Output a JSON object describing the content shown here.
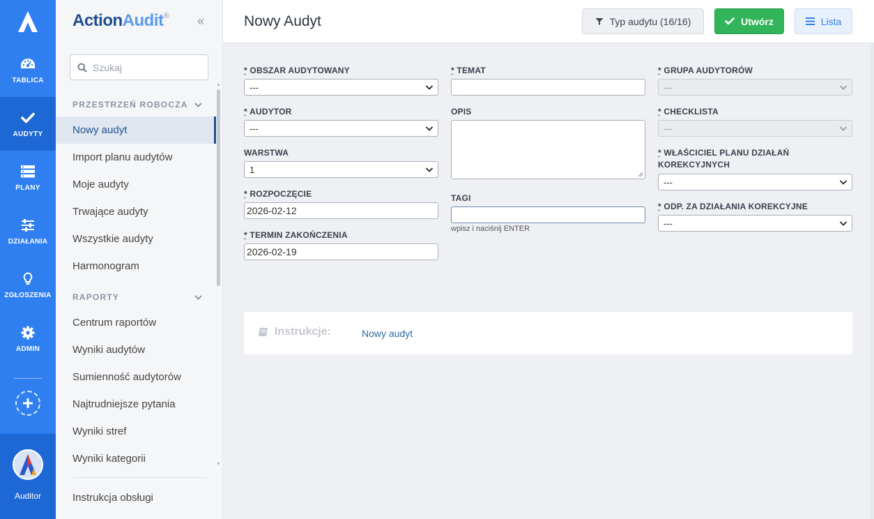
{
  "rail": {
    "items": [
      {
        "label": "TABLICA",
        "icon": "dashboard-icon"
      },
      {
        "label": "AUDYTY",
        "icon": "check-icon"
      },
      {
        "label": "PLANY",
        "icon": "plans-icon"
      },
      {
        "label": "DZIAŁANIA",
        "icon": "sliders-icon"
      },
      {
        "label": "ZGŁOSZENIA",
        "icon": "lightbulb-icon"
      },
      {
        "label": "ADMIN",
        "icon": "gear-icon"
      }
    ],
    "active_index": 1,
    "user_label": "Auditor"
  },
  "sidebar": {
    "brand_part1": "Action",
    "brand_part2": "Audit",
    "brand_reg": "®",
    "search_placeholder": "Szukaj",
    "sections": [
      {
        "title": "PRZESTRZEŃ ROBOCZA",
        "items": [
          "Nowy audyt",
          "Import planu audytów",
          "Moje audyty",
          "Trwające audyty",
          "Wszystkie audyty",
          "Harmonogram"
        ]
      },
      {
        "title": "RAPORTY",
        "items": [
          "Centrum raportów",
          "Wyniki audytów",
          "Sumienność audytorów",
          "Najtrudniejsze pytania",
          "Wyniki stref",
          "Wyniki kategorii"
        ]
      }
    ],
    "footer_item": "Instrukcja obsługi"
  },
  "header": {
    "title": "Nowy Audyt",
    "type_button": "Typ audytu (16/16)",
    "create_button": "Utwórz",
    "list_button": "Lista"
  },
  "form": {
    "col1": {
      "obszar_label": "OBSZAR AUDYTOWANY",
      "obszar_value": "---",
      "audytor_label": "AUDYTOR",
      "audytor_value": "---",
      "warstwa_label": "WARSTWA",
      "warstwa_value": "1",
      "rozpoczecie_label": "ROZPOCZĘCIE",
      "rozpoczecie_value": "2026-02-12",
      "termin_label": "TERMIN ZAKOŃCZENIA",
      "termin_value": "2026-02-19"
    },
    "col2": {
      "temat_label": "TEMAT",
      "temat_value": "",
      "opis_label": "OPIS",
      "tagi_label": "TAGI",
      "tagi_hint": "wpisz i naciśnij ENTER"
    },
    "col3": {
      "grupa_label": "GRUPA AUDYTORÓW",
      "grupa_value": "---",
      "checklista_label": "CHECKLISTA",
      "checklista_value": "---",
      "wlasciciel_label_1": "WŁAŚCICIEL PLANU DZIAŁAŃ",
      "wlasciciel_label_2": "KOREKCYJNYCH",
      "wlasciciel_value": "---",
      "odp_label": "ODP. ZA DZIAŁANIA KOREKCYJNE",
      "odp_value": "---"
    },
    "required_mark": "*"
  },
  "instructions": {
    "label": "Instrukcje:",
    "link": "Nowy audyt"
  },
  "colors": {
    "rail": "#2f7ff0",
    "rail_active": "#1e68d6",
    "create_green": "#32b45a",
    "brand_dark": "#1f4f8f",
    "brand_light": "#5b9bea"
  }
}
